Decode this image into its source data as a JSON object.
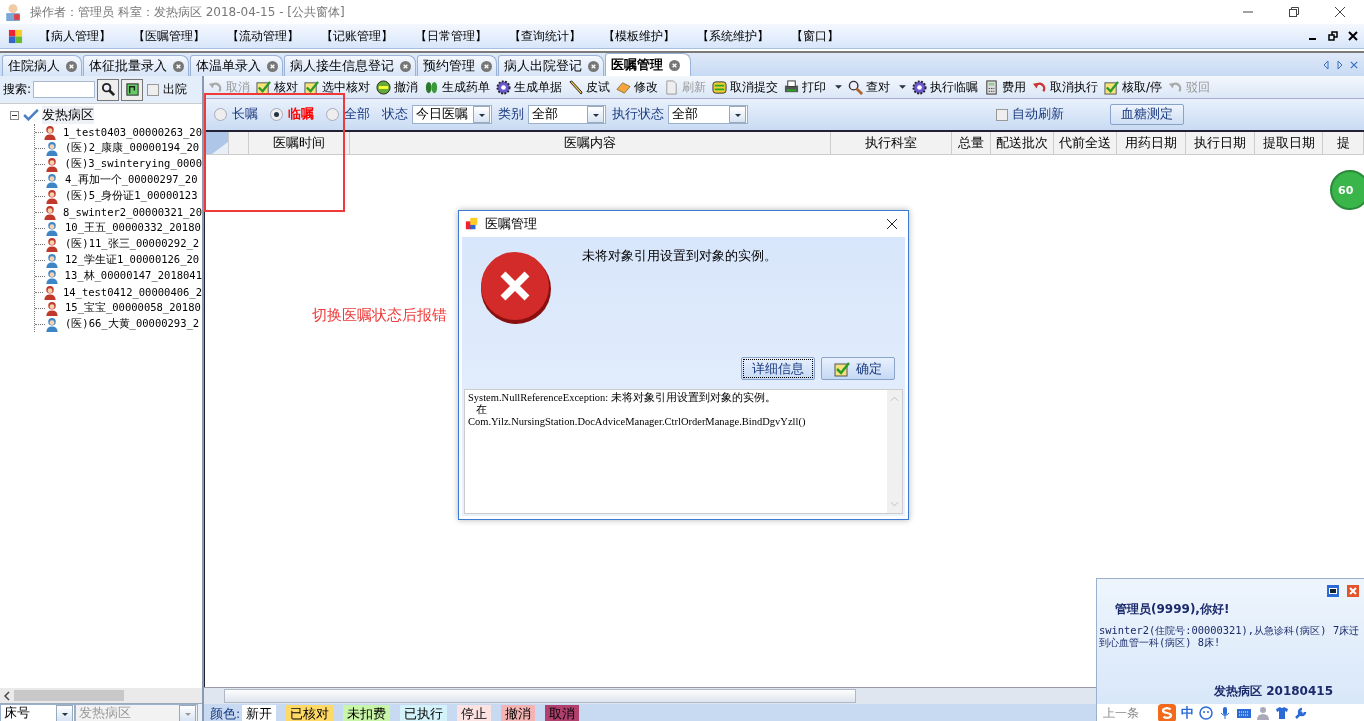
{
  "window": {
    "title": "操作者：管理员  科室：发热病区  2018-04-15 - [公共窗体]"
  },
  "menu": [
    "【病人管理】",
    "【医嘱管理】",
    "【流动管理】",
    "【记账管理】",
    "【日常管理】",
    "【查询统计】",
    "【模板维护】",
    "【系统维护】",
    "【窗口】"
  ],
  "tabs": [
    {
      "label": "住院病人",
      "selected": false
    },
    {
      "label": "体征批量录入",
      "selected": false
    },
    {
      "label": "体温单录入",
      "selected": false
    },
    {
      "label": "病人接生信息登记",
      "selected": false
    },
    {
      "label": "预约管理",
      "selected": false
    },
    {
      "label": "病人出院登记",
      "selected": false
    },
    {
      "label": "医嘱管理",
      "selected": true
    }
  ],
  "sidebar": {
    "search_label": "搜索:",
    "discharged": {
      "label": "出院",
      "checked": false
    },
    "tree": {
      "label": "发热病区",
      "expanded": true,
      "children": [
        {
          "label": "1_test0403_00000263_20",
          "kind": "female"
        },
        {
          "label": "(医)2_康康_00000194_20",
          "kind": "male"
        },
        {
          "label": "(医)3_swinterying_0000",
          "kind": "female"
        },
        {
          "label": "4_再加一个_00000297_20",
          "kind": "male"
        },
        {
          "label": "(医)5_身份证1_00000123",
          "kind": "female"
        },
        {
          "label": "8_swinter2_00000321_20",
          "kind": "female"
        },
        {
          "label": "10_王五_00000332_20180",
          "kind": "male"
        },
        {
          "label": "(医)11_张三_00000292_2",
          "kind": "female"
        },
        {
          "label": "12_学生证1_00000126_20",
          "kind": "male"
        },
        {
          "label": "13_林_00000147_2018041",
          "kind": "male"
        },
        {
          "label": "14_test0412_00000406_2",
          "kind": "female"
        },
        {
          "label": "15_宝宝_00000058_20180",
          "kind": "female"
        },
        {
          "label": "(医)66_大黄_00000293_2",
          "kind": "male"
        }
      ]
    },
    "bed_select": "床号",
    "ward_select": {
      "value": "发热病区",
      "disabled": true
    }
  },
  "toolbar": [
    {
      "label": "取消",
      "kind": "undo",
      "disabled": true
    },
    {
      "label": "核对",
      "kind": "check",
      "disabled": false
    },
    {
      "label": "选中核对",
      "kind": "check",
      "disabled": false
    },
    {
      "label": "撤消",
      "kind": "minus",
      "disabled": false
    },
    {
      "label": "生成药单",
      "kind": "leaf",
      "disabled": false
    },
    {
      "label": "生成单据",
      "kind": "gear",
      "disabled": false
    },
    {
      "label": "皮试",
      "kind": "pencil",
      "disabled": false
    },
    {
      "label": "修改",
      "kind": "eraser",
      "disabled": false
    },
    {
      "label": "刷新",
      "kind": "doc",
      "disabled": true
    },
    {
      "label": "取消提交",
      "kind": "swap",
      "disabled": false
    },
    {
      "label": "打印",
      "kind": "printer",
      "disabled": false,
      "has_menu": true
    },
    {
      "label": "查对",
      "kind": "magnifier",
      "disabled": false,
      "has_menu": true
    },
    {
      "label": "执行临嘱",
      "kind": "gear",
      "disabled": false
    },
    {
      "label": "费用",
      "kind": "calculator",
      "disabled": false
    },
    {
      "label": "取消执行",
      "kind": "undo",
      "disabled": false
    },
    {
      "label": "核取/停",
      "kind": "check",
      "disabled": false
    },
    {
      "label": "驳回",
      "kind": "undo",
      "disabled": true
    }
  ],
  "filters": {
    "order_type": [
      {
        "label": "长嘱",
        "selected": false
      },
      {
        "label": "临嘱",
        "selected": true
      },
      {
        "label": "全部",
        "selected": false
      }
    ],
    "status_label": "状态",
    "status": "今日医嘱",
    "category_label": "类别",
    "category": "全部",
    "exec_label": "执行状态",
    "exec_status": "全部",
    "auto_refresh": {
      "label": "自动刷新",
      "checked": false
    },
    "glucose_button": "血糖测定"
  },
  "table": {
    "columns": [
      "医嘱时间",
      "医嘱内容",
      "执行科室",
      "总量",
      "配送批次",
      "代前全送",
      "用药日期",
      "执行日期",
      "提取日期",
      "提"
    ]
  },
  "legend": {
    "label": "颜色:",
    "items": [
      {
        "label": "新开",
        "color": "#ffffff"
      },
      {
        "label": "已核对",
        "color": "#ffd966"
      },
      {
        "label": "未扣费",
        "color": "#c8f5a8"
      },
      {
        "label": "已执行",
        "color": "#d4f2fa"
      },
      {
        "label": "停止",
        "color": "#fde2e2"
      },
      {
        "label": "撤消",
        "color": "#f5b4b4"
      },
      {
        "label": "取消",
        "color": "#b0406e"
      }
    ]
  },
  "annotation": "切换医嘱状态后报错",
  "badge": "60",
  "dialog": {
    "title": "医嘱管理",
    "message": "未将对象引用设置到对象的实例。",
    "buttons": [
      {
        "label": "详细信息",
        "focused": true,
        "kind": "plain"
      },
      {
        "label": "确定",
        "focused": false,
        "kind": "ok"
      }
    ],
    "details": [
      "System.NullReferenceException: 未将对象引用设置到对象的实例。",
      "   在",
      "Com.Yilz.NursingStation.DocAdviceManager.CtrlOrderManage.BindDgvYzll()"
    ]
  },
  "notification": {
    "greeting": "管理员(9999),你好!",
    "message": "swinter2(住院号:00000321),从急诊科(病区) 7床迁到心血管一科(病区) 8床!",
    "footer": "发热病区  20180415",
    "prev": "上一条",
    "ime": "中"
  }
}
